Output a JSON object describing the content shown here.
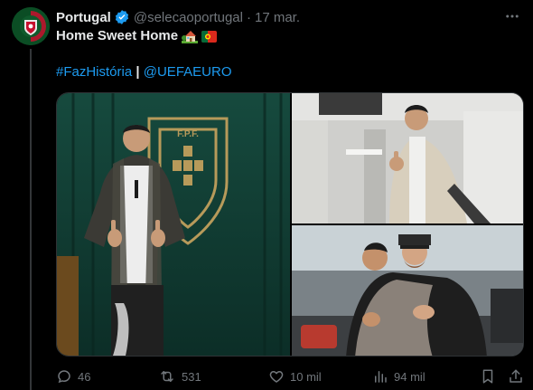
{
  "author": {
    "name": "Portugal",
    "handle": "@selecaoportugal",
    "separator": "·",
    "date": "17 mar."
  },
  "text": {
    "line1": "Home Sweet Home",
    "line1_emojis": [
      "house-with-garden",
      "portugal-flag"
    ],
    "hashtag": "#FazHistória",
    "separator": "|",
    "mention": "@UEFAEURO"
  },
  "media": {
    "photos": [
      {
        "subject": "player-thumbs-up-fpf-crest"
      },
      {
        "subject": "player-thumbs-up-corridor"
      },
      {
        "subject": "players-hugging-outdoors"
      }
    ]
  },
  "actions": {
    "replies": "46",
    "reposts": "531",
    "likes": "10 mil",
    "views": "94 mil"
  },
  "colors": {
    "background": "#000000",
    "text": "#e7e9ea",
    "muted": "#71767b",
    "link": "#1d9bf0",
    "verified": "#1d9bf0"
  },
  "icons": [
    "verified-badge-icon",
    "more-icon",
    "reply-icon",
    "repost-icon",
    "like-icon",
    "views-icon",
    "bookmark-icon",
    "share-icon"
  ]
}
